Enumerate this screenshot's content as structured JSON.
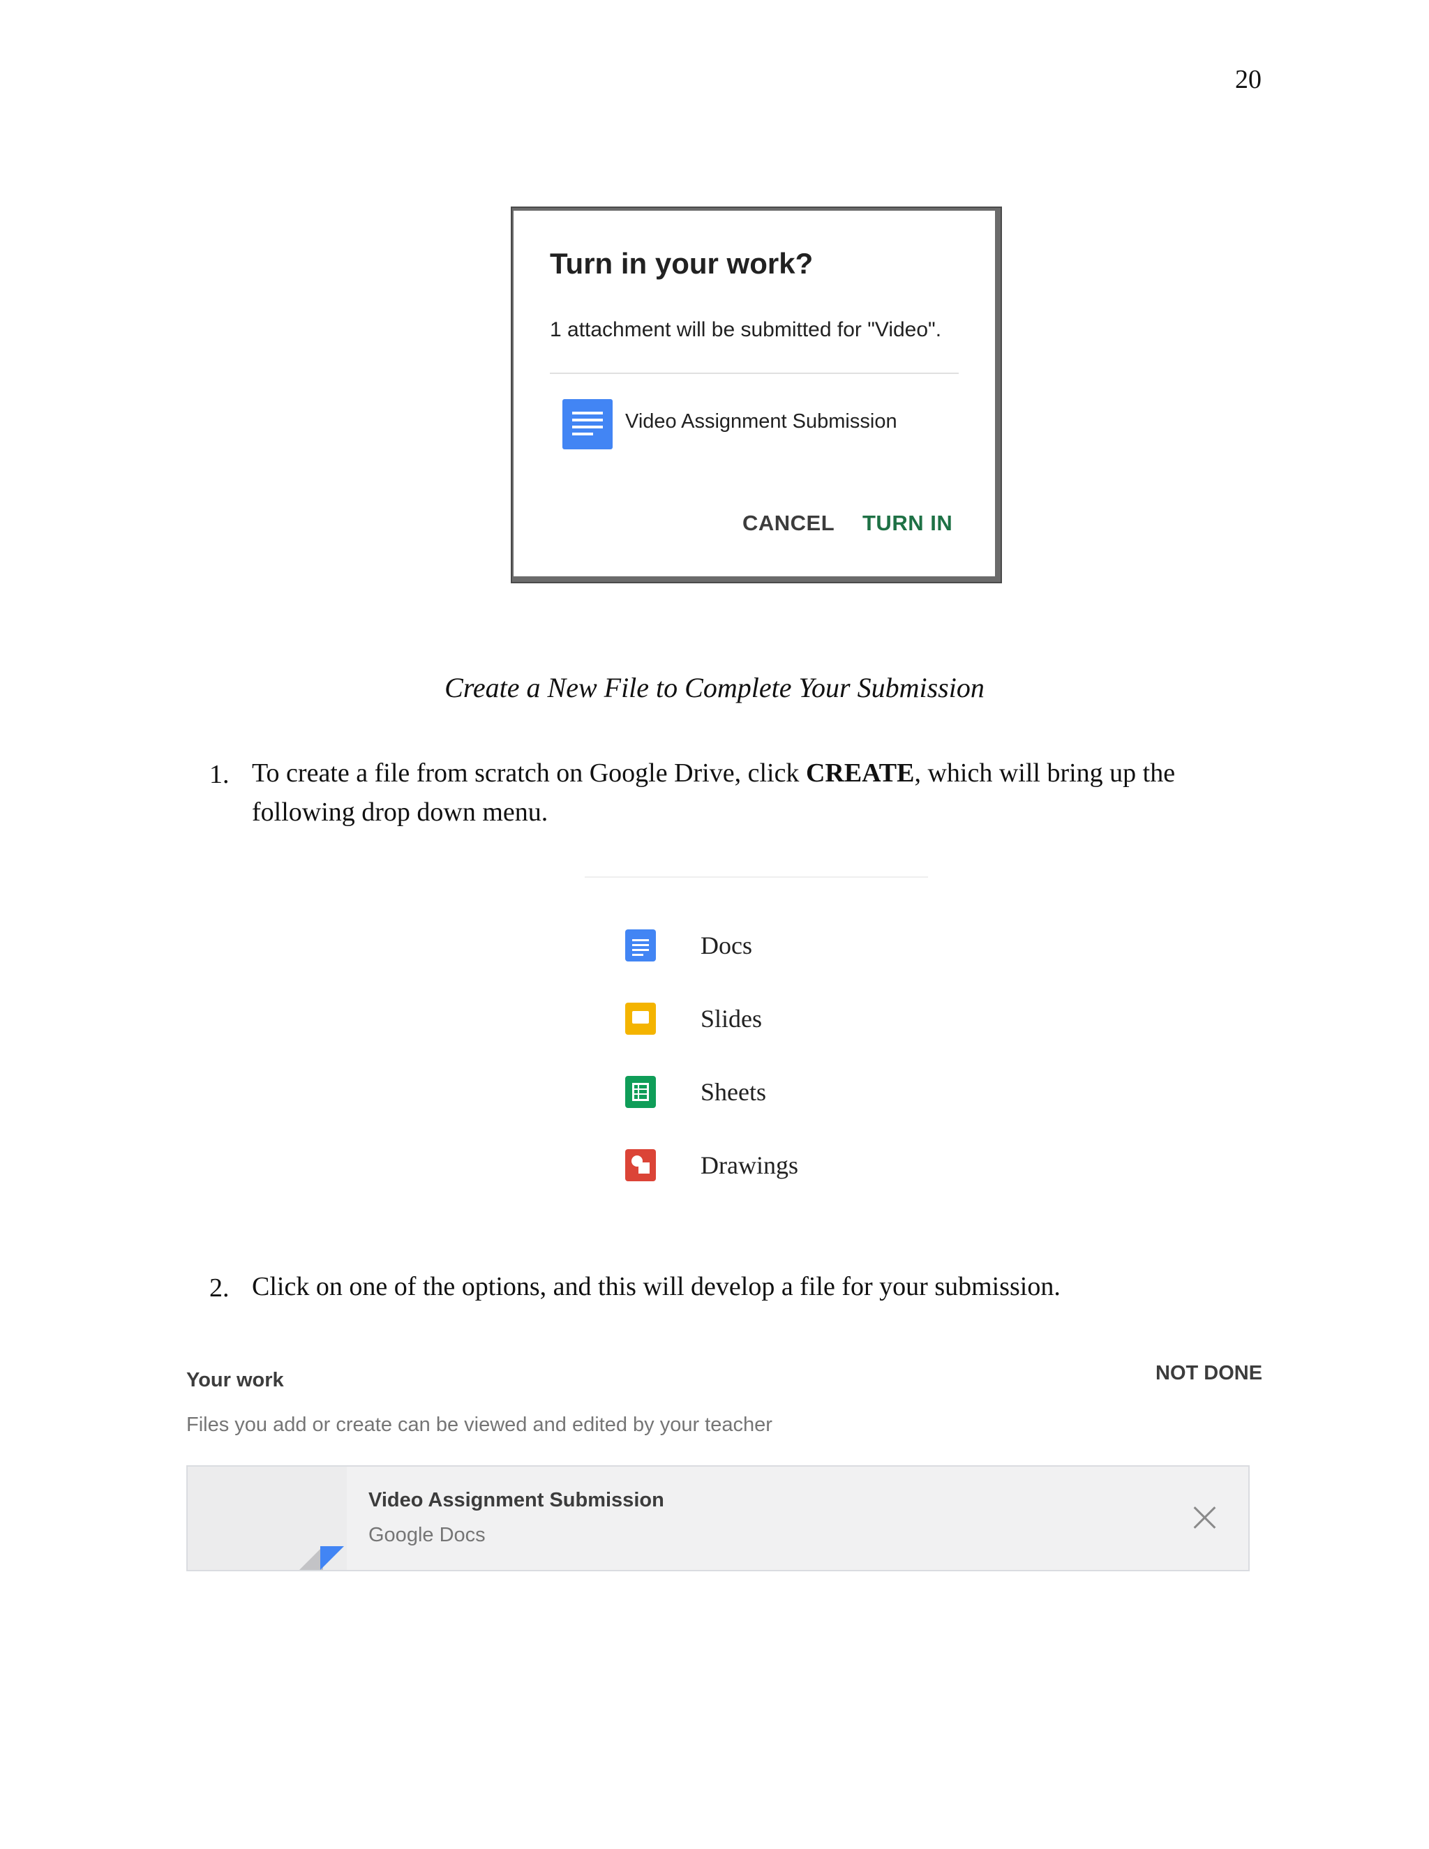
{
  "page_number": "20",
  "turn_in_dialog": {
    "title": "Turn in your work?",
    "message": "1 attachment will be submitted for \"Video\".",
    "attachment": {
      "icon": "google-docs-icon",
      "name": "Video Assignment Submission"
    },
    "cancel_label": "CANCEL",
    "turn_in_label": "TURN IN",
    "accent_color": "#1e7145"
  },
  "caption": "Create a New File to Complete Your Submission",
  "steps": [
    {
      "number": "1.",
      "text_before": "To create a file from scratch on Google Drive, click ",
      "emphasis": "CREATE",
      "text_after": ", which will bring up the",
      "text_line2": "following drop down menu."
    },
    {
      "number": "2.",
      "text": "Click on one of the options, and this will develop a file for your submission."
    }
  ],
  "create_menu": {
    "items": [
      {
        "label": "Docs",
        "icon": "docs-icon",
        "color": "#4285f4"
      },
      {
        "label": "Slides",
        "icon": "slides-icon",
        "color": "#f4b400"
      },
      {
        "label": "Sheets",
        "icon": "sheets-icon",
        "color": "#0f9d58"
      },
      {
        "label": "Drawings",
        "icon": "drawings-icon",
        "color": "#db4437"
      }
    ]
  },
  "your_work": {
    "title": "Your work",
    "status": "NOT DONE",
    "description": "Files you add or create can be viewed and edited by your teacher",
    "attachment": {
      "name": "Video Assignment Submission",
      "type": "Google Docs"
    },
    "remove_icon": "close-icon"
  }
}
